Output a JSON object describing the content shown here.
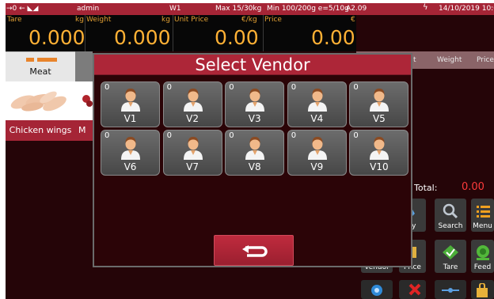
{
  "status_bar": {
    "indicators": "→0 ← ◣◢",
    "user": "admin",
    "scale_id": "W1",
    "capacity": "Max 15/30kg",
    "minimum": "Min 100/200g e=5/10g",
    "version": "A2.09",
    "datetime": "14/10/2019 10:0"
  },
  "display": {
    "tare_label": "Tare",
    "tare_unit": "kg",
    "tare_value": "0.000",
    "weight_label": "Weight",
    "weight_unit": "kg",
    "weight_value": "0.000",
    "unit_price_label": "Unit Price",
    "unit_price_unit": "€/kg",
    "unit_price_value": "0.00",
    "price_label": "Price",
    "price_unit": "€",
    "price_value": "0.00"
  },
  "categories": [
    {
      "label": "Meat"
    }
  ],
  "products": [
    {
      "name": "Chicken wings"
    },
    {
      "name": "M"
    }
  ],
  "order_table": {
    "col_partial": "t",
    "col_weight": "Weight",
    "col_price": "Price",
    "total_label": "Total:",
    "total_value": "0.00"
  },
  "function_buttons": [
    {
      "label": "ty",
      "icon": "quantity-icon"
    },
    {
      "label": "Search",
      "icon": "search-icon"
    },
    {
      "label": "Menu",
      "icon": "menu-icon"
    },
    {
      "label": "Vendor",
      "icon": "vendor-icon"
    },
    {
      "label": "Price",
      "icon": "price-icon"
    },
    {
      "label": "Tare",
      "icon": "tare-icon"
    },
    {
      "label": "Feed",
      "icon": "feed-icon"
    }
  ],
  "modal": {
    "title": "Select Vendor",
    "vendors": [
      {
        "name": "V1",
        "count": "0"
      },
      {
        "name": "V2",
        "count": "0"
      },
      {
        "name": "V3",
        "count": "0"
      },
      {
        "name": "V4",
        "count": "0"
      },
      {
        "name": "V5",
        "count": "0"
      },
      {
        "name": "V6",
        "count": "0"
      },
      {
        "name": "V7",
        "count": "0"
      },
      {
        "name": "V8",
        "count": "0"
      },
      {
        "name": "V9",
        "count": "0"
      },
      {
        "name": "V10",
        "count": "0"
      }
    ],
    "back_icon": "return-arrow-icon"
  },
  "colors": {
    "accent": "#a52536",
    "background": "#250508",
    "display_digits": "#ffb135",
    "total": "#ff3b3b"
  }
}
